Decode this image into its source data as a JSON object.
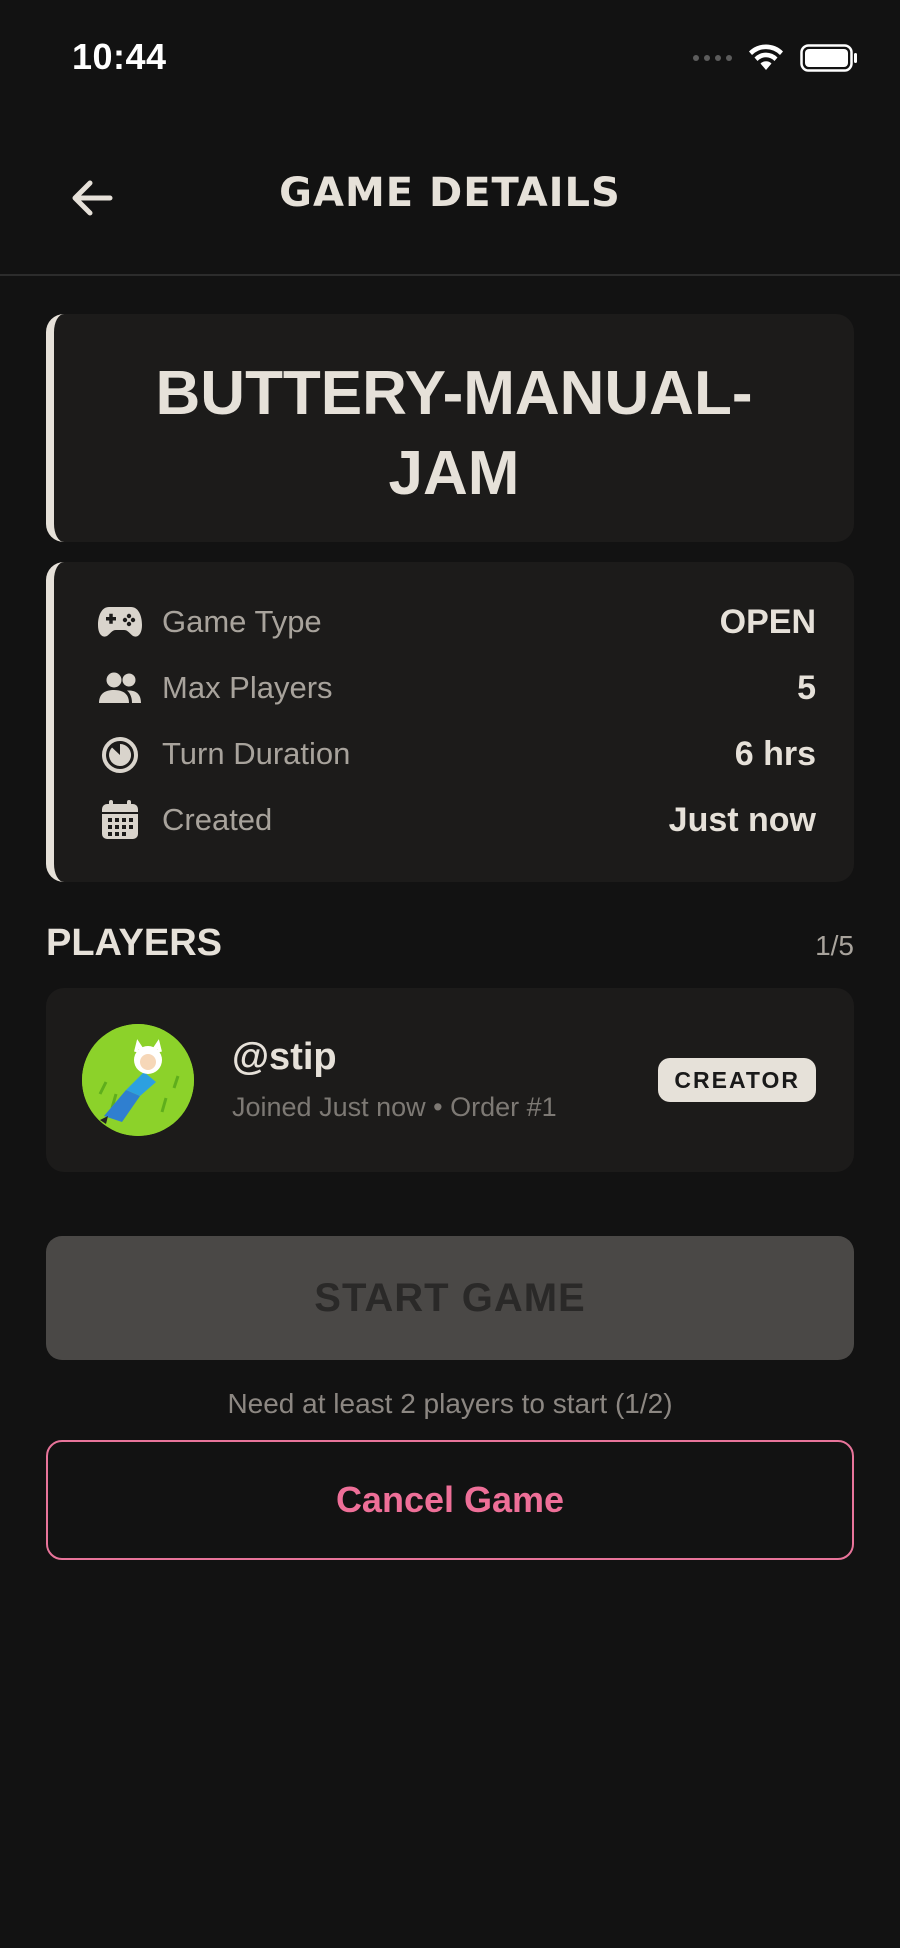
{
  "status_bar": {
    "time": "10:44"
  },
  "header": {
    "title": "GAME DETAILS",
    "back_icon": "arrow-left-icon"
  },
  "game": {
    "name": "BUTTERY-MANUAL-JAM"
  },
  "info": {
    "rows": [
      {
        "icon": "gamepad-icon",
        "label": "Game Type",
        "value": "OPEN"
      },
      {
        "icon": "users-icon",
        "label": "Max Players",
        "value": "5"
      },
      {
        "icon": "timer-icon",
        "label": "Turn Duration",
        "value": "6 hrs"
      },
      {
        "icon": "calendar-icon",
        "label": "Created",
        "value": "Just now"
      }
    ]
  },
  "players": {
    "title": "PLAYERS",
    "count": "1/5",
    "list": [
      {
        "name": "@stip",
        "meta": "Joined Just now • Order #1",
        "badge": "CREATOR"
      }
    ]
  },
  "actions": {
    "start_label": "START GAME",
    "hint": "Need at least 2 players to start (1/2)",
    "cancel_label": "Cancel Game"
  },
  "colors": {
    "background": "#121212",
    "card": "#1c1b1a",
    "accent": "#e6e1d9",
    "cancel": "#ee6f98",
    "disabled_button": "#4a4846",
    "avatar_bg": "#8cd22a"
  }
}
